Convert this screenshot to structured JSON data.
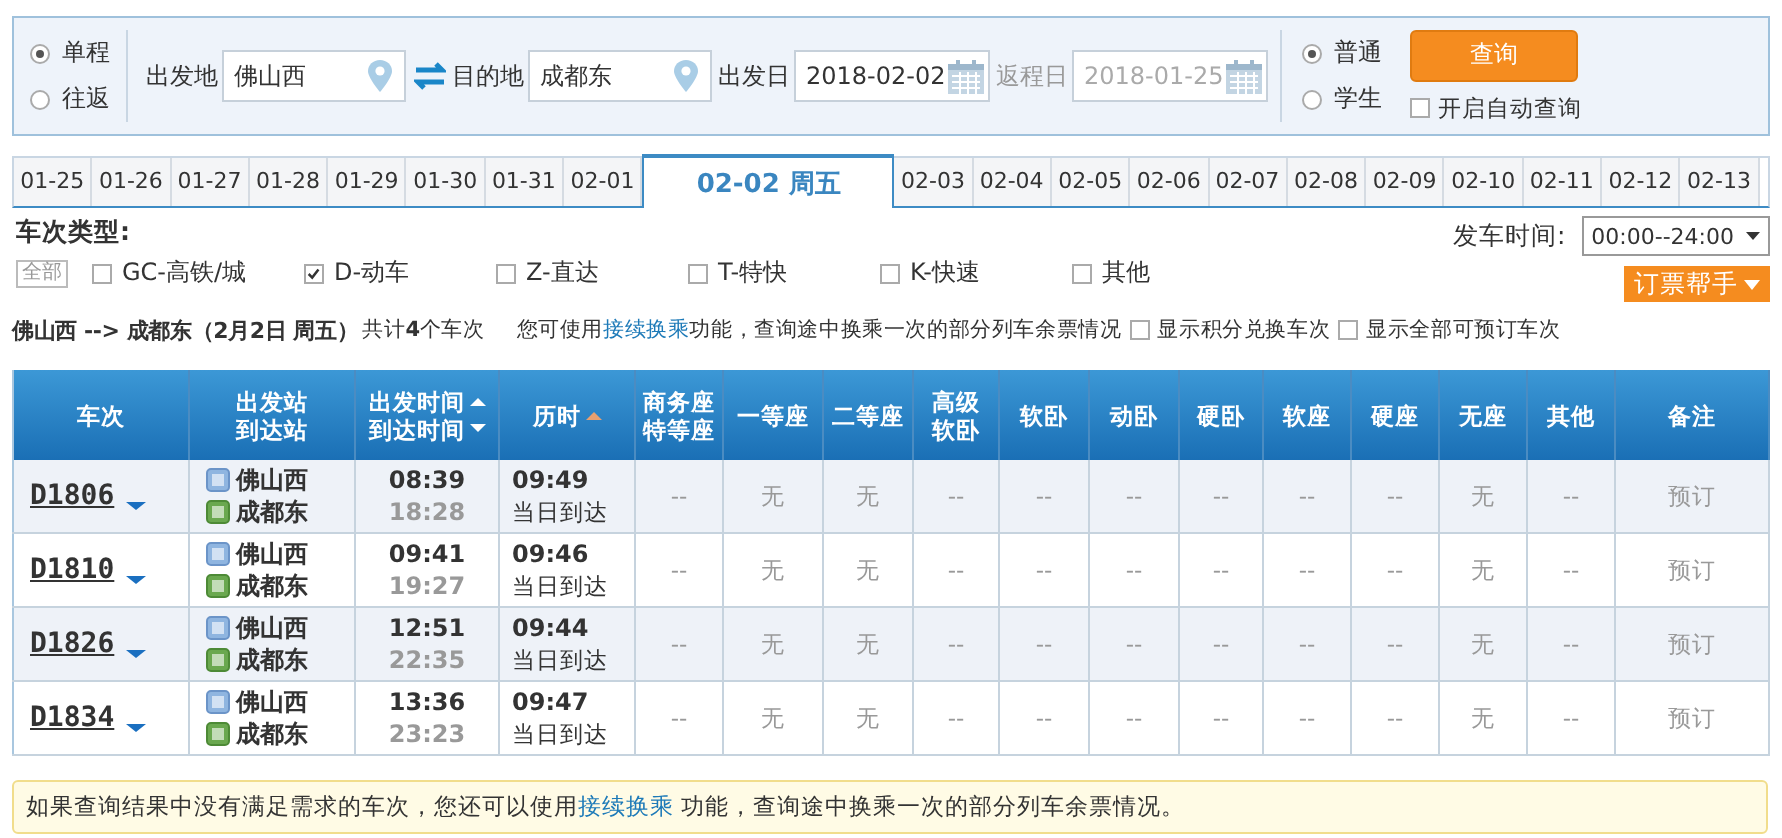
{
  "search": {
    "trip_types": [
      {
        "label": "单程",
        "selected": true
      },
      {
        "label": "往返",
        "selected": false
      }
    ],
    "fields": [
      {
        "kind": "station",
        "label": "出发地",
        "value": "佛山西"
      },
      {
        "kind": "station",
        "label": "目的地",
        "value": "成都东",
        "swap": true
      },
      {
        "kind": "date",
        "label": "出发日",
        "value": "2018-02-02",
        "disabled": false
      },
      {
        "kind": "date",
        "label": "返程日",
        "value": "2018-01-25",
        "disabled": true
      }
    ],
    "passenger_types": [
      {
        "label": "普通",
        "selected": true
      },
      {
        "label": "学生",
        "selected": false
      }
    ],
    "query_button": "查询",
    "auto_query": {
      "label": "开启自动查询",
      "checked": false
    }
  },
  "date_tabs": [
    {
      "label": "01-25",
      "selected": false
    },
    {
      "label": "01-26",
      "selected": false
    },
    {
      "label": "01-27",
      "selected": false
    },
    {
      "label": "01-28",
      "selected": false
    },
    {
      "label": "01-29",
      "selected": false
    },
    {
      "label": "01-30",
      "selected": false
    },
    {
      "label": "01-31",
      "selected": false
    },
    {
      "label": "02-01",
      "selected": false
    },
    {
      "label": "02-02 周五",
      "selected": true
    },
    {
      "label": "02-03",
      "selected": false
    },
    {
      "label": "02-04",
      "selected": false
    },
    {
      "label": "02-05",
      "selected": false
    },
    {
      "label": "02-06",
      "selected": false
    },
    {
      "label": "02-07",
      "selected": false
    },
    {
      "label": "02-08",
      "selected": false
    },
    {
      "label": "02-09",
      "selected": false
    },
    {
      "label": "02-10",
      "selected": false
    },
    {
      "label": "02-11",
      "selected": false
    },
    {
      "label": "02-12",
      "selected": false
    },
    {
      "label": "02-13",
      "selected": false
    }
  ],
  "filter": {
    "title": "车次类型:",
    "all_button": "全部",
    "train_types": [
      {
        "label": "GC-高铁/城",
        "checked": false
      },
      {
        "label": "D-动车",
        "checked": true
      },
      {
        "label": "Z-直达",
        "checked": false
      },
      {
        "label": "T-特快",
        "checked": false
      },
      {
        "label": "K-快速",
        "checked": false
      },
      {
        "label": "其他",
        "checked": false
      }
    ],
    "depart_time_label": "发车时间:",
    "depart_time": "00:00--24:00",
    "helper_button": "订票帮手"
  },
  "summary": {
    "route": "佛山西 --> 成都东（2月2日  周五）",
    "count": "共计**4**个车次",
    "notice_before": "您可使用",
    "notice_link": "接续换乘",
    "notice_after": "功能，查询途中换乘一次的部分列车余票情况",
    "options": [
      {
        "label": "显示积分兑换车次",
        "checked": false
      },
      {
        "label": "显示全部可预订车次",
        "checked": false
      }
    ]
  },
  "table": {
    "columns": [
      {
        "lines": [
          "车次"
        ]
      },
      {
        "lines": [
          "出发站",
          "到达站"
        ]
      },
      {
        "lines": [
          "出发时间",
          "到达时间"
        ],
        "sort_up": true,
        "sort_down": true,
        "sort_active": false
      },
      {
        "lines": [
          "历时"
        ],
        "sort_up": true,
        "sort_down": false,
        "sort_active": true
      },
      {
        "lines": [
          "商务座",
          "特等座"
        ]
      },
      {
        "lines": [
          "一等座"
        ]
      },
      {
        "lines": [
          "二等座"
        ]
      },
      {
        "lines": [
          "高级",
          "软卧"
        ]
      },
      {
        "lines": [
          "软卧"
        ]
      },
      {
        "lines": [
          "动卧"
        ]
      },
      {
        "lines": [
          "硬卧"
        ]
      },
      {
        "lines": [
          "软座"
        ]
      },
      {
        "lines": [
          "硬座"
        ]
      },
      {
        "lines": [
          "无座"
        ]
      },
      {
        "lines": [
          "其他"
        ]
      },
      {
        "lines": [
          "备注"
        ]
      }
    ],
    "rows": [
      {
        "train": "D1806",
        "from": "佛山西",
        "to": "成都东",
        "depart": "08:39",
        "arrive": "18:28",
        "duration": "09:49",
        "arrival_day": "当日到达",
        "seats": [
          "--",
          "无",
          "无",
          "--",
          "--",
          "--",
          "--",
          "--",
          "--",
          "无",
          "--"
        ],
        "note": "预订"
      },
      {
        "train": "D1810",
        "from": "佛山西",
        "to": "成都东",
        "depart": "09:41",
        "arrive": "19:27",
        "duration": "09:46",
        "arrival_day": "当日到达",
        "seats": [
          "--",
          "无",
          "无",
          "--",
          "--",
          "--",
          "--",
          "--",
          "--",
          "无",
          "--"
        ],
        "note": "预订"
      },
      {
        "train": "D1826",
        "from": "佛山西",
        "to": "成都东",
        "depart": "12:51",
        "arrive": "22:35",
        "duration": "09:44",
        "arrival_day": "当日到达",
        "seats": [
          "--",
          "无",
          "无",
          "--",
          "--",
          "--",
          "--",
          "--",
          "--",
          "无",
          "--"
        ],
        "note": "预订"
      },
      {
        "train": "D1834",
        "from": "佛山西",
        "to": "成都东",
        "depart": "13:36",
        "arrive": "23:23",
        "duration": "09:47",
        "arrival_day": "当日到达",
        "seats": [
          "--",
          "无",
          "无",
          "--",
          "--",
          "--",
          "--",
          "--",
          "--",
          "无",
          "--"
        ],
        "note": "预订"
      }
    ]
  },
  "footer": {
    "before": "如果查询结果中没有满足需求的车次，您还可以使用",
    "link": "接续换乘",
    "after": " 功能，查询途中换乘一次的部分列车余票情况。"
  }
}
